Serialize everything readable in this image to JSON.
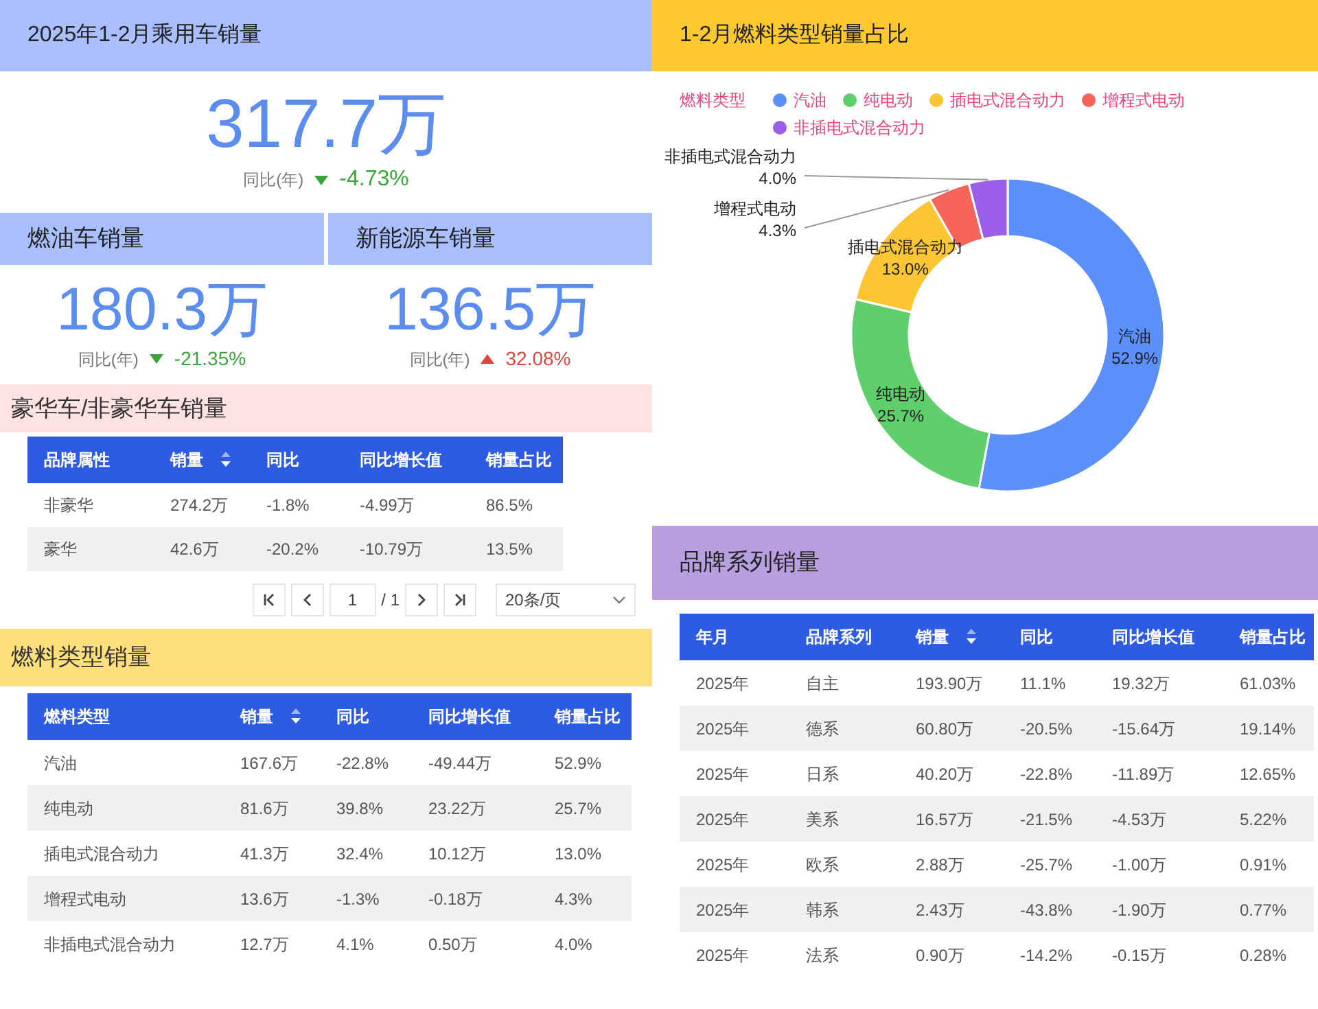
{
  "overview": {
    "title": "2025年1-2月乘用车销量",
    "value": "317.7万",
    "yoy_label": "同比(年)",
    "change": "-4.73%",
    "increase": false
  },
  "segments": [
    {
      "title": "燃油车销量",
      "value": "180.3万",
      "yoy_label": "同比(年)",
      "change": "-21.35%",
      "increase": false
    },
    {
      "title": "新能源车销量",
      "value": "136.5万",
      "yoy_label": "同比(年)",
      "change": "32.08%",
      "increase": true
    }
  ],
  "luxury": {
    "title": "豪华车/非豪华车销量",
    "table": {
      "columns": [
        {
          "label": "品牌属性",
          "sortable": false
        },
        {
          "label": "销量",
          "sortable": true
        },
        {
          "label": "同比",
          "sortable": false
        },
        {
          "label": "同比增长值",
          "sortable": false
        },
        {
          "label": "销量占比",
          "sortable": false
        }
      ],
      "rows": [
        [
          "非豪华",
          "274.2万",
          "-1.8%",
          "-4.99万",
          "86.5%"
        ],
        [
          "豪华",
          "42.6万",
          "-20.2%",
          "-10.79万",
          "13.5%"
        ]
      ]
    },
    "pagination": {
      "page": "1",
      "total": "/ 1",
      "page_size": "20条/页"
    }
  },
  "fuel_sales": {
    "title": "燃料类型销量",
    "table": {
      "columns": [
        {
          "label": "燃料类型",
          "sortable": false
        },
        {
          "label": "销量",
          "sortable": true
        },
        {
          "label": "同比",
          "sortable": false
        },
        {
          "label": "同比增长值",
          "sortable": false
        },
        {
          "label": "销量占比",
          "sortable": false
        }
      ],
      "rows": [
        [
          "汽油",
          "167.6万",
          "-22.8%",
          "-49.44万",
          "52.9%"
        ],
        [
          "纯电动",
          "81.6万",
          "39.8%",
          "23.22万",
          "25.7%"
        ],
        [
          "插电式混合动力",
          "41.3万",
          "32.4%",
          "10.12万",
          "13.0%"
        ],
        [
          "增程式电动",
          "13.6万",
          "-1.3%",
          "-0.18万",
          "4.3%"
        ],
        [
          "非插电式混合动力",
          "12.7万",
          "4.1%",
          "0.50万",
          "4.0%"
        ]
      ]
    }
  },
  "fuel_share": {
    "title": "1-2月燃料类型销量占比",
    "legend_title": "燃料类型",
    "legend": [
      {
        "label": "汽油",
        "color": "#5b8ff9"
      },
      {
        "label": "纯电动",
        "color": "#5fcf6c"
      },
      {
        "label": "插电式混合动力",
        "color": "#fbc534"
      },
      {
        "label": "增程式电动",
        "color": "#f7645a"
      },
      {
        "label": "非插电式混合动力",
        "color": "#9b5ee8"
      }
    ],
    "chart_data": {
      "type": "donut",
      "categories": [
        "汽油",
        "纯电动",
        "插电式混合动力",
        "增程式电动",
        "非插电式混合动力"
      ],
      "values": [
        52.9,
        25.7,
        13.0,
        4.3,
        4.0
      ],
      "value_labels": [
        "52.9%",
        "25.7%",
        "13.0%",
        "4.3%",
        "4.0%"
      ]
    }
  },
  "brand_series": {
    "title": "品牌系列销量",
    "table": {
      "columns": [
        {
          "label": "年月",
          "sortable": false
        },
        {
          "label": "品牌系列",
          "sortable": false
        },
        {
          "label": "销量",
          "sortable": true
        },
        {
          "label": "同比",
          "sortable": false
        },
        {
          "label": "同比增长值",
          "sortable": false
        },
        {
          "label": "销量占比",
          "sortable": false
        }
      ],
      "rows": [
        [
          "2025年",
          "自主",
          "193.90万",
          "11.1%",
          "19.32万",
          "61.03%"
        ],
        [
          "2025年",
          "德系",
          "60.80万",
          "-20.5%",
          "-15.64万",
          "19.14%"
        ],
        [
          "2025年",
          "日系",
          "40.20万",
          "-22.8%",
          "-11.89万",
          "12.65%"
        ],
        [
          "2025年",
          "美系",
          "16.57万",
          "-21.5%",
          "-4.53万",
          "5.22%"
        ],
        [
          "2025年",
          "欧系",
          "2.88万",
          "-25.7%",
          "-1.00万",
          "0.91%"
        ],
        [
          "2025年",
          "韩系",
          "2.43万",
          "-43.8%",
          "-1.90万",
          "0.77%"
        ],
        [
          "2025年",
          "法系",
          "0.90万",
          "-14.2%",
          "-0.15万",
          "0.28%"
        ]
      ]
    }
  }
}
